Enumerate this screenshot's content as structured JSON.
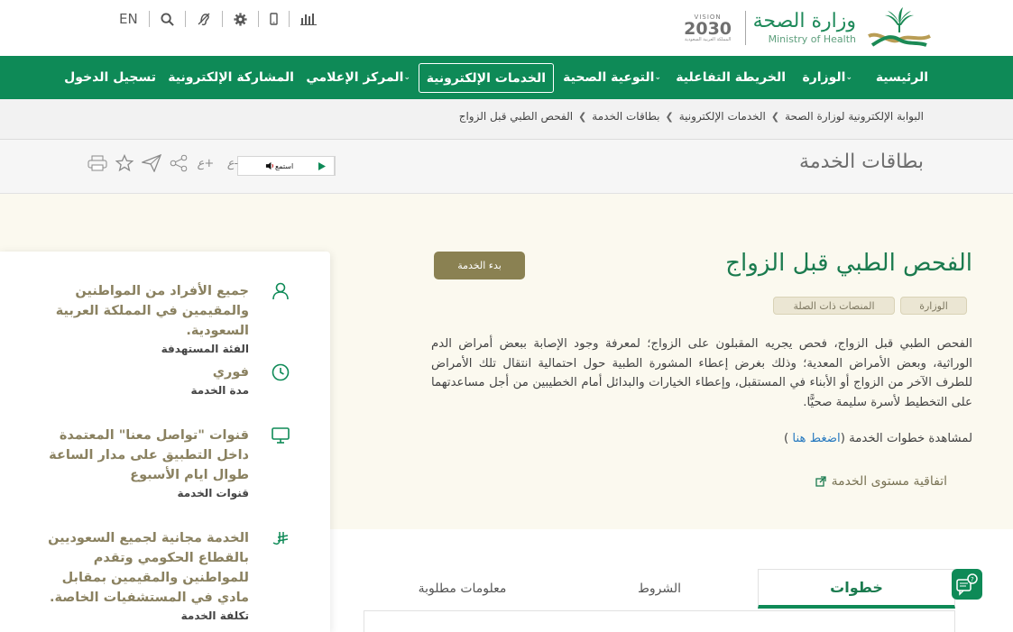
{
  "header": {
    "lang_toggle": "EN",
    "brand_ar": "وزارة الصحة",
    "brand_en": "Ministry of Health",
    "vision": {
      "top": "VISION",
      "year": "2030",
      "sub": "المملكة العربية السعودية"
    }
  },
  "nav": {
    "home": "الرئيسية",
    "ministry": "الوزارة",
    "interactive_map": "الخريطة التفاعلية",
    "health_awareness": "التوعية الصحية",
    "eservices": "الخدمات الإلكترونية",
    "media_center": "المركز الإعلامي",
    "eparticipation": "المشاركة الإلكترونية",
    "login": "تسجيل الدخول"
  },
  "breadcrumb": [
    "البوابة الإلكترونية لوزارة الصحة",
    "الخدمات الإلكترونية",
    "بطاقات الخدمة",
    "الفحص الطبي قبل الزواج"
  ],
  "page_title": "بطاقات الخدمة",
  "listen_label": "استمع",
  "service": {
    "title": "الفحص الطبي قبل الزواج",
    "start_button": "بدء الخدمة",
    "tags": [
      "الوزارة",
      "المنصات ذات الصلة"
    ],
    "description": "الفحص الطبي قبل الزواج، فحص يجريه المقبلون على الزواج؛ لمعرفة وجود الإصابة ببعض أمراض الدم الوراثية، وبعض الأمراض المعدية؛ وذلك بغرض إعطاء المشورة الطبية حول احتمالية انتقال تلك الأمراض للطرف الآخر من الزواج أو الأبناء في المستقبل، وإعطاء الخيارات والبدائل أمام الخطيبين من أجل مساعدتهما على التخطيط لأسرة سليمة صحيًّا.",
    "steps_prefix": "لمشاهدة خطوات الخدمة (",
    "steps_link": "اضغط هنا",
    "steps_suffix": " )",
    "sla_link": "اتفاقية مستوى الخدمة"
  },
  "card": [
    {
      "icon": "user-icon",
      "value": "جميع الأفراد من المواطنين والمقيمين في المملكة العربية السعودية.",
      "caption": "الفئة المستهدفة"
    },
    {
      "icon": "clock-icon",
      "value": "فوري",
      "caption": "مدة الخدمة"
    },
    {
      "icon": "monitor-icon",
      "value": "قنوات \"تواصل معنا\" المعتمدة داخل التطبيق على مدار الساعة طوال ايام الأسبوع",
      "caption": "قنوات الخدمة"
    },
    {
      "icon": "riyal-icon",
      "value": "الخدمة مجانية لجميع السعوديين بالقطاع الحكومي وتقدم للمواطنين والمقيمين بمقابل مادي في المستشفيات الخاصة.",
      "caption": "تكلفة الخدمة"
    }
  ],
  "tabs": [
    "خطوات",
    "الشروط",
    "معلومات مطلوبة"
  ],
  "colors": {
    "primary": "#0e8a57",
    "accent": "#8a8152",
    "band": "#fbf9ef"
  }
}
